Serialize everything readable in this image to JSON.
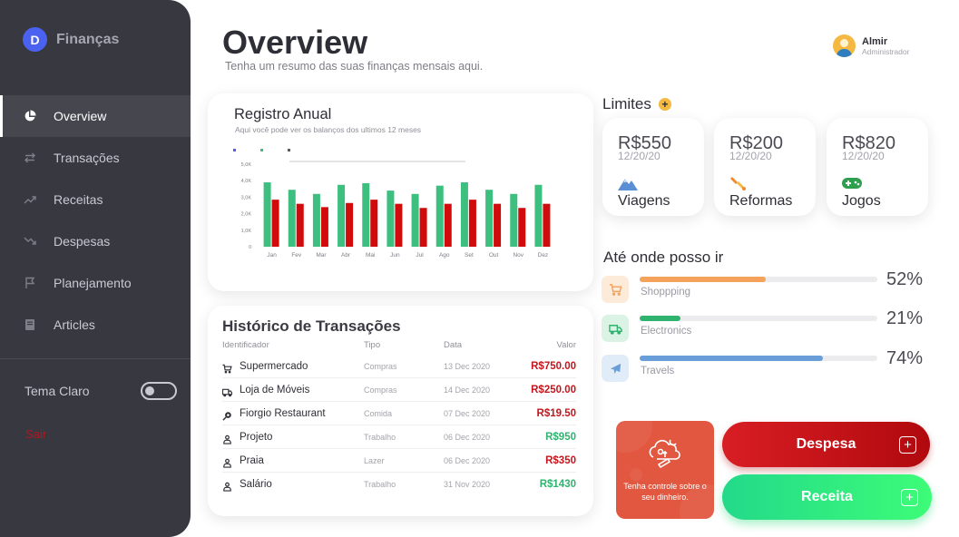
{
  "app": {
    "name": "Finanças",
    "logo_letter": "D"
  },
  "sidebar": {
    "items": [
      {
        "label": "Overview",
        "icon": "pie-chart-icon",
        "active": true
      },
      {
        "label": "Transações",
        "icon": "transfer-icon"
      },
      {
        "label": "Receitas",
        "icon": "trend-up-icon"
      },
      {
        "label": "Despesas",
        "icon": "trend-down-icon"
      },
      {
        "label": "Planejamento",
        "icon": "flag-icon"
      },
      {
        "label": "Articles",
        "icon": "book-icon"
      }
    ],
    "theme_label": "Tema Claro",
    "logout_label": "Sair"
  },
  "header": {
    "title": "Overview",
    "subtitle": "Tenha um resumo das suas finanças mensais aqui."
  },
  "user": {
    "name": "Almir",
    "role": "Administrador"
  },
  "annual": {
    "title": "Registro Anual",
    "subtitle": "Aqui você pode ver os balanços dos ultimos 12 meses"
  },
  "chart_data": {
    "type": "bar",
    "categories": [
      "Jan",
      "Fev",
      "Mar",
      "Abr",
      "Mai",
      "Jun",
      "Jul",
      "Ago",
      "Set",
      "Out",
      "Nov",
      "Dez"
    ],
    "series": [
      {
        "values": [
          3900,
          3450,
          3200,
          3750,
          3850,
          3400,
          3200,
          3700,
          3900,
          3450,
          3200,
          3750
        ],
        "color": "#3cbf7f"
      },
      {
        "values": [
          2850,
          2600,
          2400,
          2650,
          2850,
          2600,
          2350,
          2600,
          2850,
          2600,
          2350,
          2600
        ],
        "color": "#d10b0b"
      }
    ],
    "yticks": [
      "0",
      "1,0K",
      "2,0K",
      "3,0K",
      "4,0K",
      "5,0K"
    ],
    "ylim": [
      0,
      5000
    ],
    "legend_colors": [
      "#4b61f0",
      "#3cbf7f",
      "#5a5a63"
    ]
  },
  "transactions": {
    "title": "Histórico de Transações",
    "headers": {
      "id": "Identificador",
      "type": "Tipo",
      "date": "Data",
      "value": "Valor"
    },
    "rows": [
      {
        "name": "Supermercado",
        "icon": "cart-icon",
        "type": "Compras",
        "date": "13 Dec 2020",
        "value": "R$750.00",
        "color": "#c4161c"
      },
      {
        "name": "Loja de Móveis",
        "icon": "truck-icon",
        "type": "Compras",
        "date": "14 Dec 2020",
        "value": "R$250.00",
        "color": "#c4161c"
      },
      {
        "name": "Fiorgio Restaurant",
        "icon": "food-icon",
        "type": "Comida",
        "date": "07 Dec 2020",
        "value": "R$19.50",
        "color": "#c4161c"
      },
      {
        "name": "Projeto",
        "icon": "person-icon",
        "type": "Trabalho",
        "date": "06 Dec 2020",
        "value": "R$950",
        "color": "#2fb36f"
      },
      {
        "name": "Praia",
        "icon": "person-icon",
        "type": "Lazer",
        "date": "06 Dec 2020",
        "value": "R$350",
        "color": "#c4161c"
      },
      {
        "name": "Salário",
        "icon": "person-icon",
        "type": "Trabalho",
        "date": "31 Nov 2020",
        "value": "R$1430",
        "color": "#2fb36f"
      }
    ]
  },
  "limits": {
    "title": "Limites",
    "items": [
      {
        "amount": "R$550",
        "date": "12/20/20",
        "label": "Viagens",
        "icon": "mountain-icon"
      },
      {
        "amount": "R$200",
        "date": "12/20/20",
        "label": "Reformas",
        "icon": "tools-icon"
      },
      {
        "amount": "R$820",
        "date": "12/20/20",
        "label": "Jogos",
        "icon": "gamepad-icon"
      }
    ]
  },
  "progress": {
    "title": "Até onde posso ir",
    "items": [
      {
        "label": "Shoppping",
        "percent_text": "52%",
        "fraction": 0.53,
        "color": "#f5a25d",
        "bg": "#fdebd9",
        "icon": "cart-icon"
      },
      {
        "label": "Electronics",
        "percent_text": "21%",
        "fraction": 0.17,
        "color": "#2fb36f",
        "bg": "#daf3e5",
        "icon": "truck-icon"
      },
      {
        "label": "Travels",
        "percent_text": "74%",
        "fraction": 0.77,
        "color": "#6a9ed8",
        "bg": "#e1ecf9",
        "icon": "plane-icon"
      }
    ]
  },
  "promo": {
    "text": "Tenha controle sobre o seu dinheiro.",
    "icon": "cloud-money-icon"
  },
  "actions": {
    "despesa_label": "Despesa",
    "receita_label": "Receita",
    "plus": "+"
  }
}
